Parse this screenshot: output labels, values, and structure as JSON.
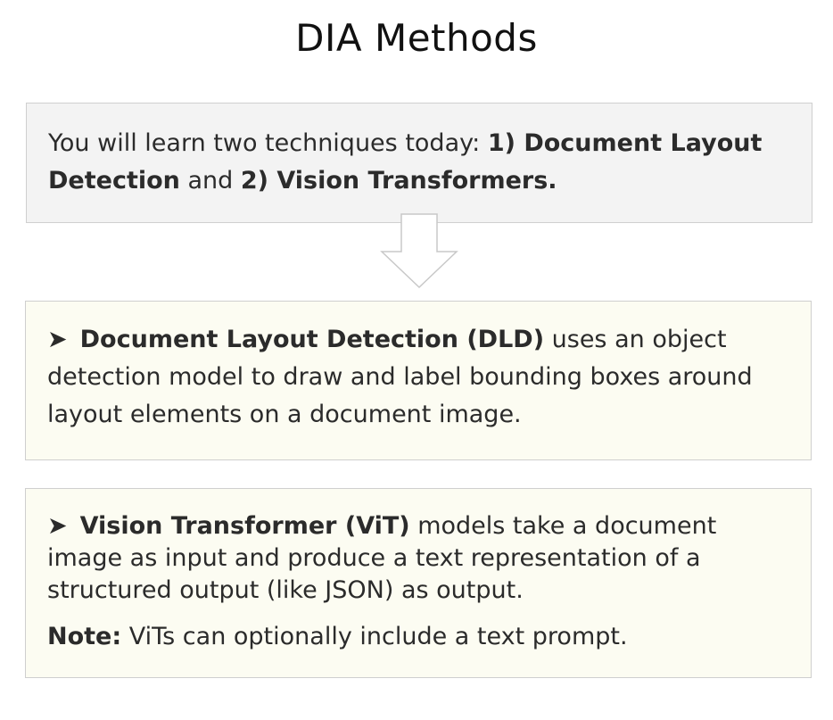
{
  "title": "DIA Methods",
  "intro": {
    "prefix": "You will learn two techniques today: ",
    "item1": "1) Document Layout Detection",
    "middle": " and ",
    "item2": "2) Vision Transformers."
  },
  "arrow_icon": "down-arrow-icon",
  "dld": {
    "bullet": "➤",
    "term": "Document Layout Detection (DLD)",
    "description": " uses an object detection model to draw and label bounding boxes around layout elements on a document image."
  },
  "vit": {
    "bullet": "➤",
    "term": "Vision Transformer (ViT)",
    "description": " models take a document image as input and produce a text representation of a structured output (like JSON) as output.",
    "note_label": "Note:",
    "note_text": " ViTs can optionally include a text prompt."
  },
  "colors": {
    "intro_bg": "#f3f3f3",
    "card_bg": "#fcfcf2",
    "border": "#cfcfcf"
  }
}
